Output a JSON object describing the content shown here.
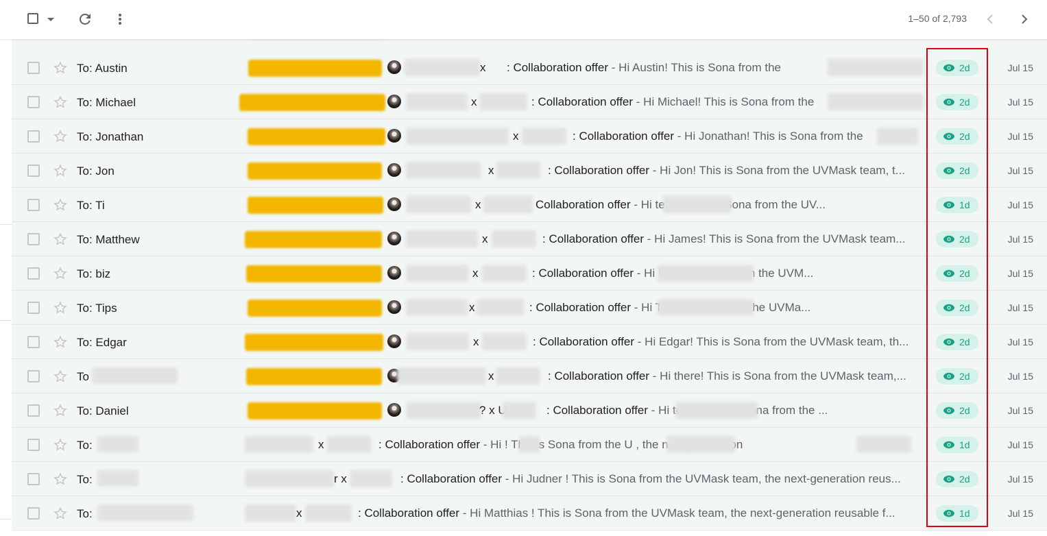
{
  "toolbar": {
    "pager_text": "1–50 of 2,793",
    "icons": [
      "checkbox-icon",
      "caret-down-icon",
      "refresh-icon",
      "more-vert-icon",
      "chevron-left-icon",
      "chevron-right-icon"
    ]
  },
  "colors": {
    "row_bg": "#f2f6f5",
    "badge_bg": "#d5f2ea",
    "badge_text": "#1aa184",
    "highlight": "#e0000b",
    "label_yellow": "#f2b600"
  },
  "rows": [
    {
      "to": "To: Austin",
      "subject": ": Collaboration offer",
      "snippet": " - Hi Austin! This is Sona from the",
      "badge": "2d",
      "date": "Jul 15"
    },
    {
      "to": "To: Michael",
      "subject": ": Collaboration offer",
      "snippet": " - Hi Michael! This is Sona from the",
      "badge": "2d",
      "date": "Jul 15"
    },
    {
      "to": "To: Jonathan",
      "subject": ": Collaboration offer",
      "snippet": " - Hi Jonathan! This is Sona from the",
      "badge": "2d",
      "date": "Jul 15"
    },
    {
      "to": "To: Jon",
      "subject": ": Collaboration offer",
      "snippet": " - Hi Jon! This is Sona from the UVMask team, t...",
      "badge": "2d",
      "date": "Jul 15"
    },
    {
      "to": "To: Ti",
      "subject": "Collaboration offer",
      "snippet": " - Hi                       team! This is Sona from the UV...",
      "badge": "1d",
      "date": "Jul 15"
    },
    {
      "to": "To: Matthew",
      "subject": ": Collaboration offer",
      "snippet": " - Hi James! This is Sona from the UVMask team...",
      "badge": "2d",
      "date": "Jul 15"
    },
    {
      "to": "To: biz",
      "subject": ": Collaboration offer",
      "snippet": " - Hi                                  ! This is Sona from the UVM...",
      "badge": "2d",
      "date": "Jul 15"
    },
    {
      "to": "To: Tips",
      "subject": ": Collaboration offer",
      "snippet": " - Hi                              This is Sona from the UVMa...",
      "badge": "2d",
      "date": "Jul 15"
    },
    {
      "to": "To: Edgar",
      "subject": ": Collaboration offer",
      "snippet": " - Hi Edgar! This is Sona from the UVMask team, th...",
      "badge": "2d",
      "date": "Jul 15"
    },
    {
      "to": "To",
      "subject": ": Collaboration offer",
      "snippet": " - Hi there! This is Sona from the UVMask team,...",
      "badge": "2d",
      "date": "Jul 15"
    },
    {
      "to": "To: Daniel",
      "subject": ": Collaboration offer",
      "snippet": " - Hi                              team! This is Sona from the ...",
      "badge": "2d",
      "date": "Jul 15"
    },
    {
      "to": "To:",
      "subject": ": Collaboration offer",
      "snippet": " - Hi          ! This is Sona from the U                         , the next-generation",
      "badge": "1d",
      "date": "Jul 15"
    },
    {
      "to": "To:",
      "subject": ": Collaboration offer",
      "snippet": " - Hi Judner ! This is Sona from the UVMask team, the next-generation reus...",
      "badge": "2d",
      "date": "Jul 15"
    },
    {
      "to": "To:",
      "subject": ": Collaboration offer",
      "snippet": " - Hi Matthias ! This is Sona from the UVMask team, the next-generation reusable f...",
      "badge": "1d",
      "date": "Jul 15"
    }
  ],
  "x_marks": [
    "x",
    "x",
    "x",
    "x",
    "x",
    "x",
    "x",
    "x",
    "x",
    "x",
    "? x U",
    "x",
    "r x",
    "x"
  ]
}
